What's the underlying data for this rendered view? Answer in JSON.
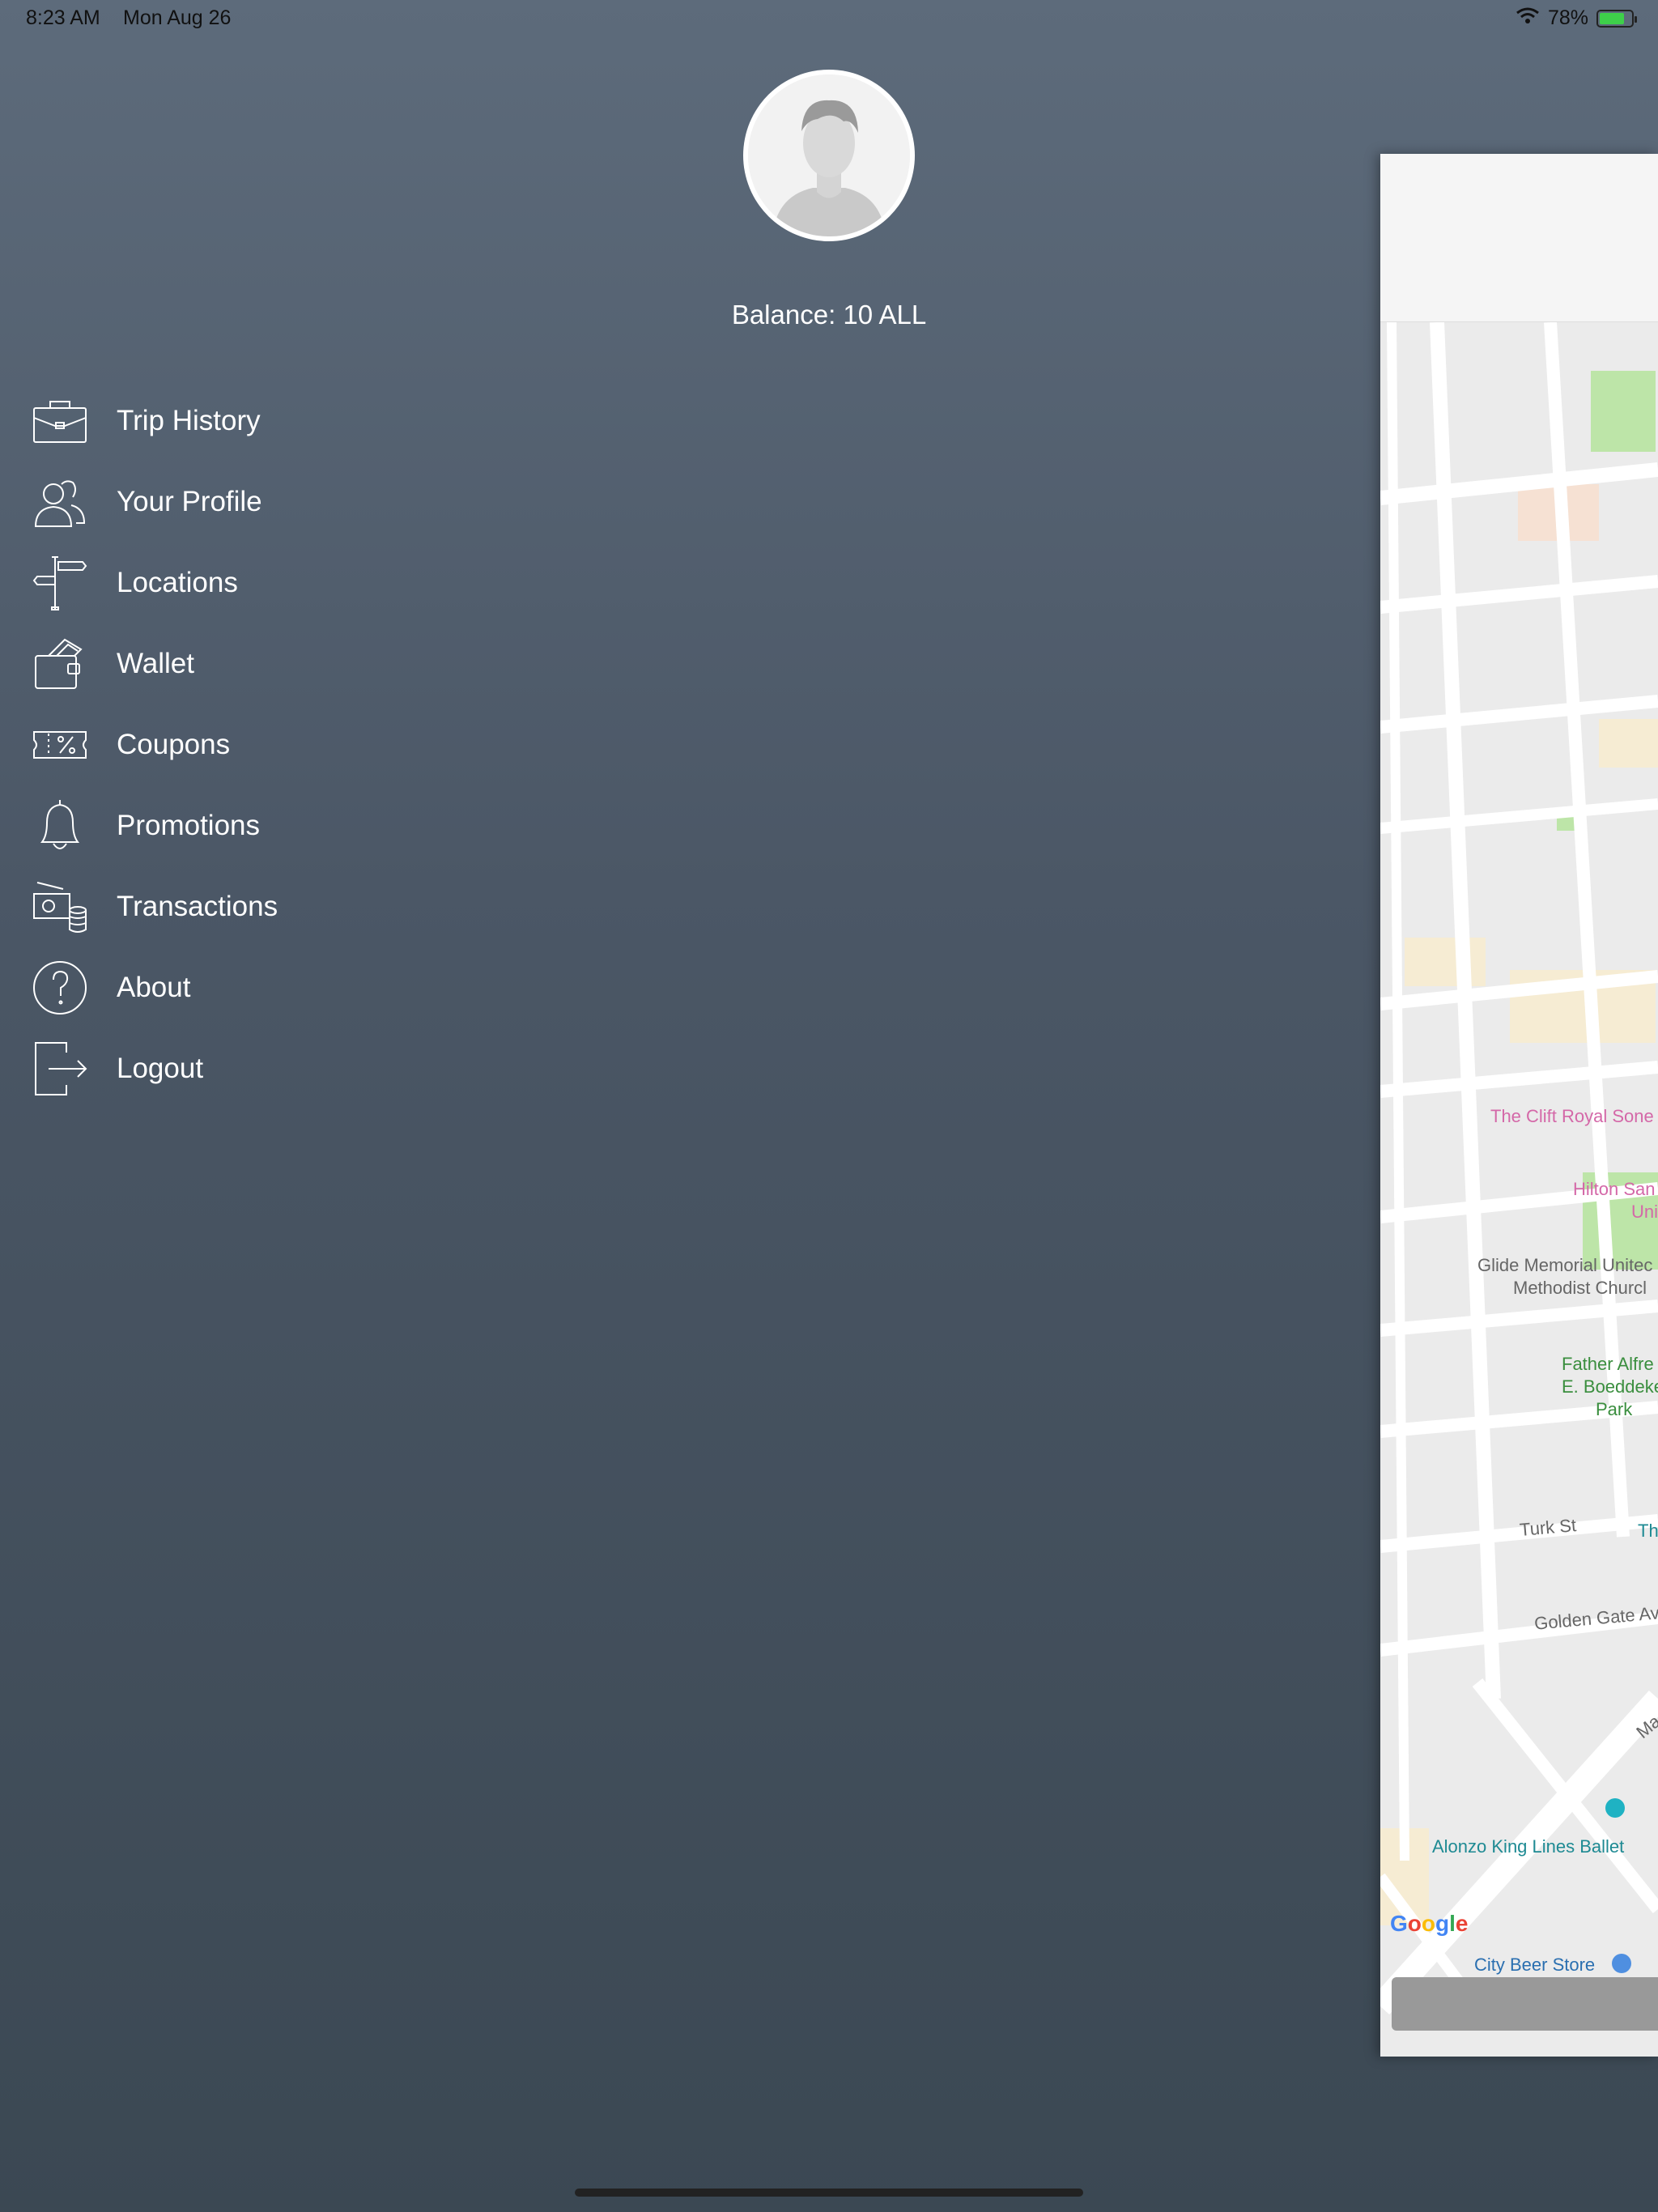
{
  "status_bar": {
    "time": "8:23 AM",
    "date": "Mon Aug 26",
    "battery_text": "78%",
    "battery_level": 0.78,
    "wifi_icon": "wifi-icon",
    "battery_icon": "battery-charging-icon"
  },
  "profile": {
    "avatar_icon": "user-avatar-icon",
    "balance": "Balance: 10 ALL"
  },
  "menu": {
    "items": [
      {
        "label": "Trip History",
        "icon": "briefcase-icon"
      },
      {
        "label": "Your Profile",
        "icon": "users-icon"
      },
      {
        "label": "Locations",
        "icon": "signpost-icon"
      },
      {
        "label": "Wallet",
        "icon": "wallet-icon"
      },
      {
        "label": "Coupons",
        "icon": "coupon-icon"
      },
      {
        "label": "Promotions",
        "icon": "bell-icon"
      },
      {
        "label": "Transactions",
        "icon": "money-icon"
      },
      {
        "label": "About",
        "icon": "question-icon"
      },
      {
        "label": "Logout",
        "icon": "logout-icon"
      }
    ]
  },
  "map": {
    "labels": {
      "clift": "The Clift Royal Sone",
      "hilton_1": "Hilton San",
      "hilton_2": "Uni",
      "glide_1": "Glide Memorial Unitec",
      "glide_2": "Methodist Churcl",
      "father_1": "Father Alfre",
      "father_2": "E. Boeddeke",
      "father_3": "Park",
      "turk": "Turk St",
      "th": "Th",
      "golden_gate": "Golden Gate Av",
      "ma": "Ma",
      "alonzo": "Alonzo King Lines Ballet",
      "city_beer": "City Beer Store"
    },
    "attribution": "Google",
    "colors": {
      "road": "#ffffff",
      "block": "#ebebeb",
      "park": "#bde5a8",
      "building": "#f6ecd3"
    }
  },
  "accent_colors": {
    "background_top": "#5d6b7b",
    "background_bottom": "#3b4853"
  }
}
